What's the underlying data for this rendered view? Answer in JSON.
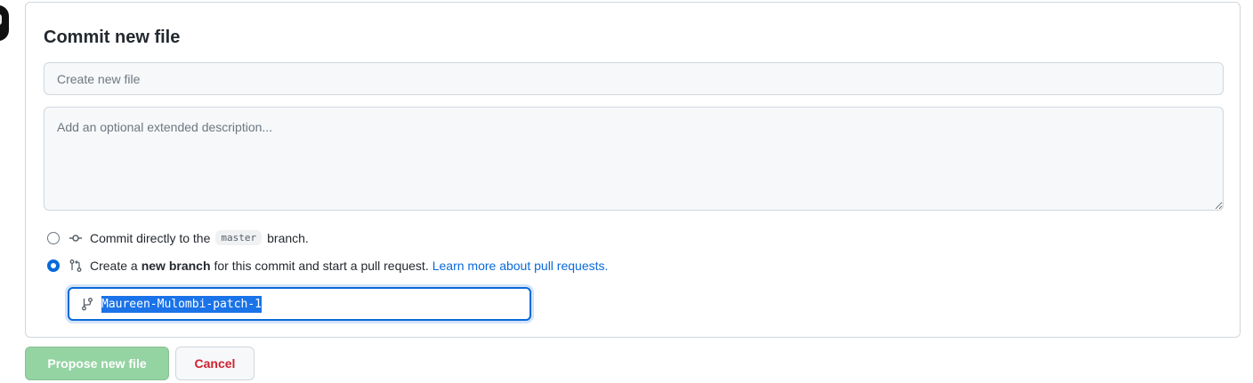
{
  "form": {
    "title": "Commit new file",
    "summary_placeholder": "Create new file",
    "description_placeholder": "Add an optional extended description..."
  },
  "options": {
    "direct": {
      "prefix": "Commit directly to the",
      "branch": "master",
      "suffix": "branch.",
      "selected": false
    },
    "new_branch": {
      "prefix": "Create a",
      "bold": "new branch",
      "suffix": "for this commit and start a pull request.",
      "link": "Learn more about pull requests.",
      "selected": true
    }
  },
  "branch_input": {
    "value": "Maureen-Mulombi-patch-1"
  },
  "buttons": {
    "propose": "Propose new file",
    "cancel": "Cancel"
  },
  "colors": {
    "accent": "#0969da",
    "primary_button": "#94d3a2",
    "cancel_text": "#cf222e"
  }
}
